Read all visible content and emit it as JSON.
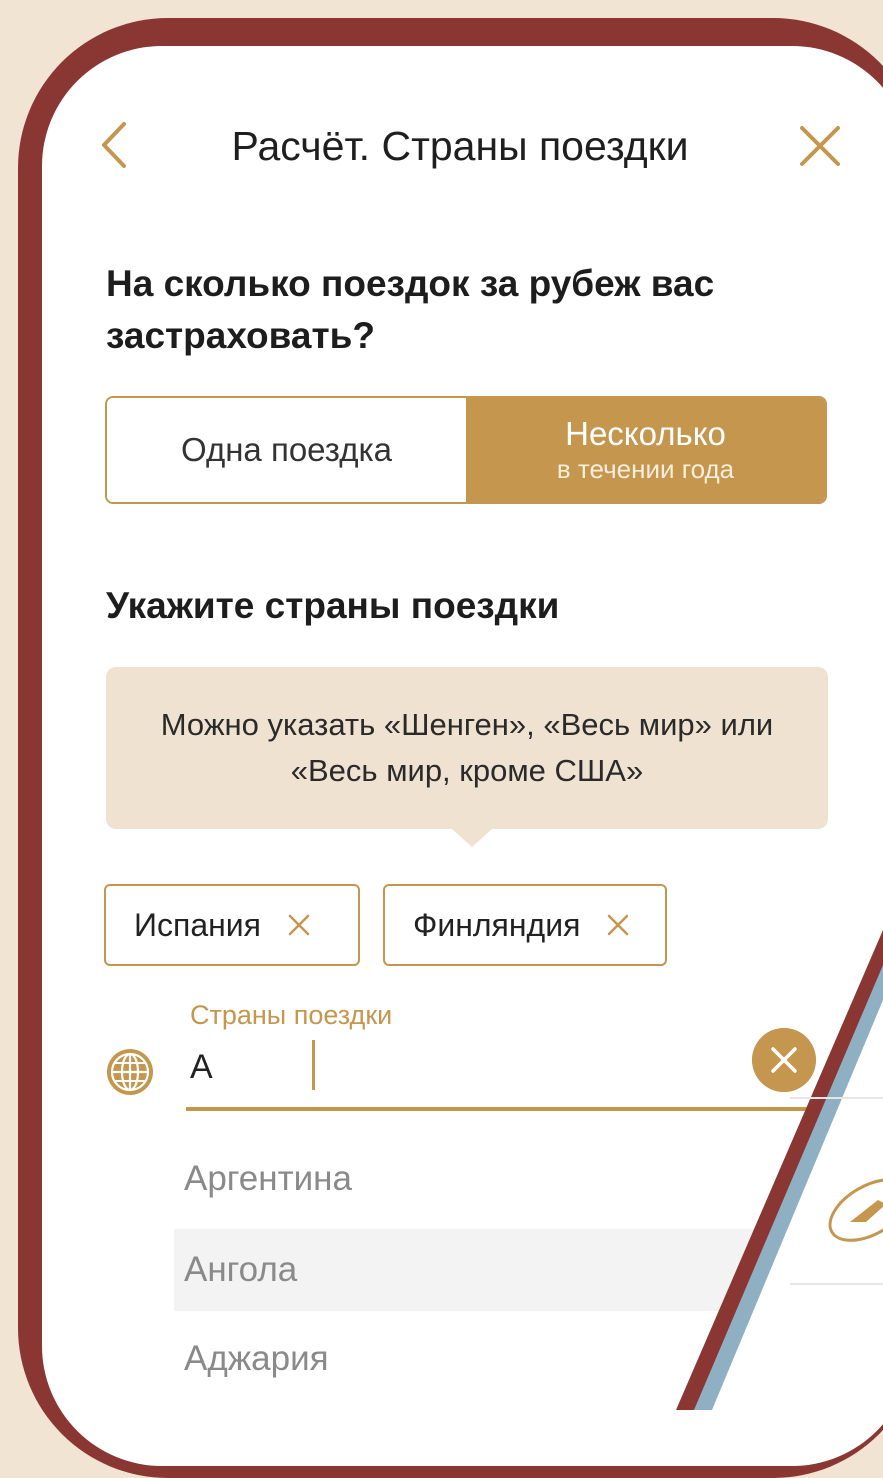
{
  "header": {
    "title": "Расчёт. Страны поездки"
  },
  "trips": {
    "question": "На сколько поездок за рубеж вас застраховать?",
    "option_one": "Одна поездка",
    "option_many": "Несколько",
    "option_many_sub": "в течении года",
    "selected": "option_many"
  },
  "countries": {
    "section_title": "Укажите страны поездки",
    "hint": "Можно указать «Шенген», «Весь мир» или «Весь мир, кроме США»",
    "chips": [
      "Испания",
      "Финляндия"
    ],
    "field_label": "Страны поездки",
    "field_value": "А",
    "suggestions": [
      "Аргентина",
      "Ангола",
      "Аджария"
    ]
  },
  "colors": {
    "accent": "#c4964e",
    "frame": "#8a3632",
    "background": "#f1e4d2",
    "hint_bg": "#efe2d1"
  },
  "icons": [
    "chevron-left-icon",
    "close-icon",
    "remove-chip-icon",
    "globe-icon",
    "clear-input-icon",
    "plane-icon"
  ]
}
